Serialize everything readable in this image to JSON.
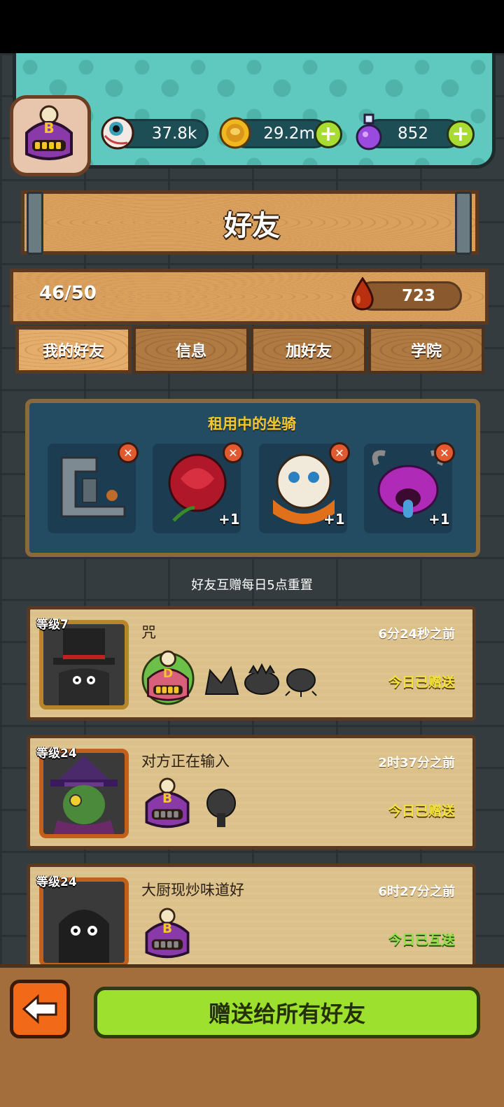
{
  "resources": {
    "eyeballs": "37.8k",
    "coins": "29.2m",
    "potions": "852"
  },
  "avatar": {
    "rank_letter": "B"
  },
  "header": {
    "title": "好友"
  },
  "stats": {
    "friend_count": "46/50",
    "blood": "723"
  },
  "tabs": [
    {
      "label": "我的好友",
      "active": true
    },
    {
      "label": "信息",
      "active": false
    },
    {
      "label": "加好友",
      "active": false
    },
    {
      "label": "学院",
      "active": false
    }
  ],
  "mounts": {
    "title": "租用中的坐骑",
    "slots": [
      {
        "name": "steam-machine",
        "bonus": ""
      },
      {
        "name": "rose",
        "bonus": "+1"
      },
      {
        "name": "lion-dance",
        "bonus": "+1"
      },
      {
        "name": "purple-demon",
        "bonus": "+1"
      }
    ]
  },
  "daily_note": "好友互赠每日5点重置",
  "friends": [
    {
      "level": "等级7",
      "name": "咒",
      "time": "6分24秒之前",
      "status": "今日已赠送",
      "rank": "D"
    },
    {
      "level": "等级24",
      "name": "对方正在输入",
      "time": "2时37分之前",
      "status": "今日已赠送",
      "rank": "B"
    },
    {
      "level": "等级24",
      "name": "大厨现炒味道好",
      "time": "6时27分之前",
      "status": "今日已互送",
      "rank": "B"
    }
  ],
  "footer": {
    "gift_all_label": "赠送给所有好友"
  },
  "colors": {
    "accent_green": "#9ee02e",
    "teal": "#5fc9bf",
    "wood": "#d9a05e"
  }
}
